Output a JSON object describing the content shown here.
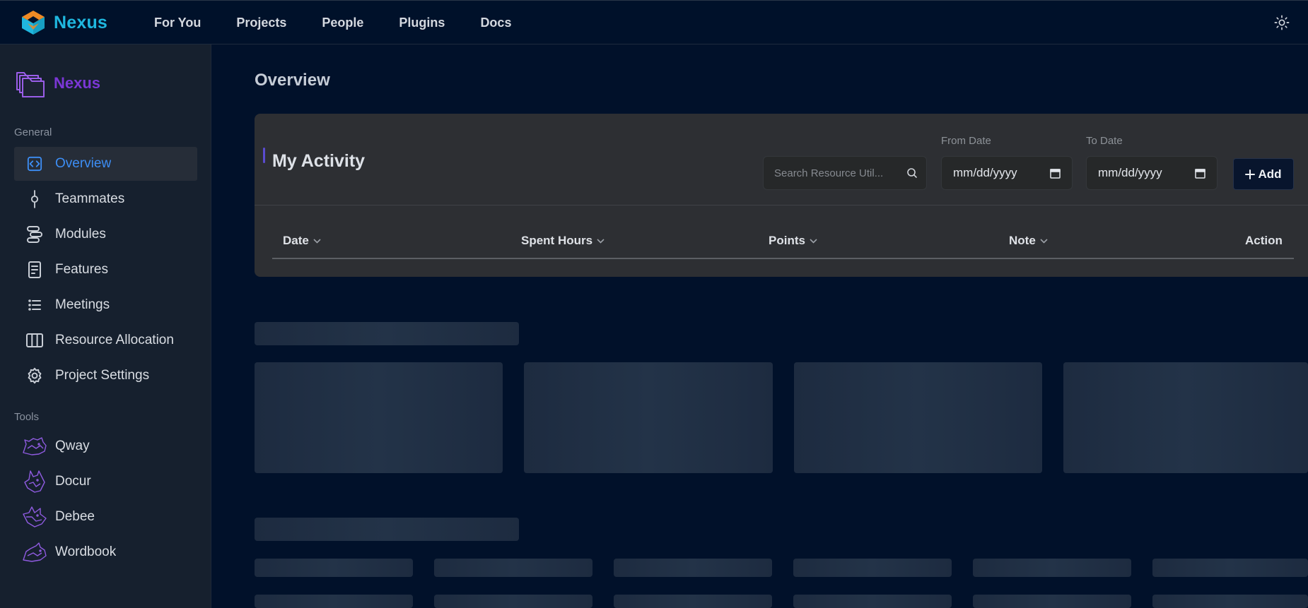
{
  "topbar": {
    "brand": "Nexus",
    "nav": [
      "For You",
      "Projects",
      "People",
      "Plugins",
      "Docs"
    ],
    "theme_icon": "sun-icon"
  },
  "sidebar": {
    "project_name": "Nexus",
    "general_label": "General",
    "general_items": [
      {
        "label": "Overview",
        "icon": "code-icon",
        "active": true
      },
      {
        "label": "Teammates",
        "icon": "commit-icon"
      },
      {
        "label": "Modules",
        "icon": "modules-icon"
      },
      {
        "label": "Features",
        "icon": "document-icon"
      },
      {
        "label": "Meetings",
        "icon": "list-icon"
      },
      {
        "label": "Resource Allocation",
        "icon": "columns-icon"
      },
      {
        "label": "Project Settings",
        "icon": "gear-icon"
      }
    ],
    "tools_label": "Tools",
    "tools_items": [
      {
        "label": "Qway",
        "icon": "animal-icon"
      },
      {
        "label": "Docur",
        "icon": "animal-icon"
      },
      {
        "label": "Debee",
        "icon": "animal-icon"
      },
      {
        "label": "Wordbook",
        "icon": "animal-icon"
      }
    ]
  },
  "main": {
    "page_title": "Overview",
    "activity": {
      "title": "My Activity",
      "search_placeholder": "Search Resource Util...",
      "from_label": "From Date",
      "to_label": "To Date",
      "from_value": "mm/dd/yyyy",
      "to_value": "mm/dd/yyyy",
      "add_label": "Add",
      "columns": [
        "Date",
        "Spent Hours",
        "Points",
        "Note",
        "Action"
      ]
    }
  },
  "colors": {
    "accent": "#3d8ef5",
    "brand": "#1fb7df",
    "project": "#7b37d6"
  }
}
